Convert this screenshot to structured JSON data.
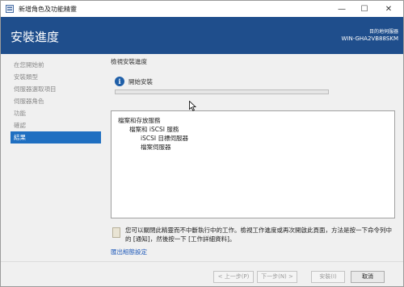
{
  "window": {
    "title": "新增角色及功能精靈",
    "min_glyph": "—",
    "max_glyph": "☐",
    "close_glyph": "✕"
  },
  "header": {
    "page_title": "安裝進度",
    "destination_label": "目的地伺服器",
    "destination_server": "WIN-GHA2VB88SKM"
  },
  "sidebar": {
    "items": [
      {
        "label": "在您開始前",
        "active": false
      },
      {
        "label": "安裝類型",
        "active": false
      },
      {
        "label": "伺服器選取項目",
        "active": false
      },
      {
        "label": "伺服器角色",
        "active": false
      },
      {
        "label": "功能",
        "active": false
      },
      {
        "label": "確認",
        "active": false
      },
      {
        "label": "結果",
        "active": true
      }
    ]
  },
  "content": {
    "section_label": "檢視安裝進度",
    "status_icon": "info-icon",
    "status_text": "開始安裝",
    "progress_fraction": 0.0,
    "results": [
      {
        "text": "檔案和存放服務",
        "level": 0
      },
      {
        "text": "檔案和 iSCSI 服務",
        "level": 1
      },
      {
        "text": "iSCSI 目標伺服器",
        "level": 2
      },
      {
        "text": "檔案伺服器",
        "level": 2
      }
    ],
    "note_text": "您可以關閉此精靈而不中斷執行中的工作。檢視工作進度或再次開啟此頁面，方法是按一下命令列中的 [通知]，然後按一下 [工作詳細資料]。",
    "export_link": "匯出組態設定"
  },
  "footer": {
    "prev_label": "< 上一步(P)",
    "next_label": "下一步(N) >",
    "install_label": "安裝(I)",
    "cancel_label": "取消"
  },
  "colors": {
    "header_bg": "#1f4e8c",
    "active_nav": "#1f6fc1",
    "link": "#1a56b8",
    "progress": "#06b025"
  }
}
